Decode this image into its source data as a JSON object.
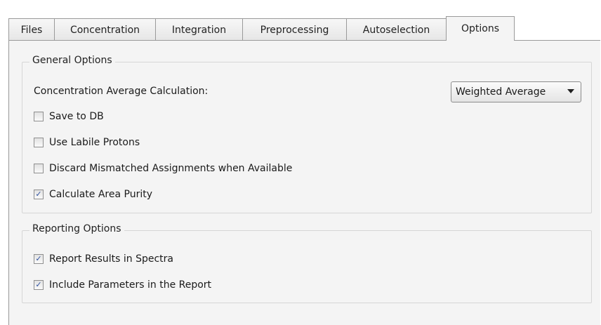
{
  "tabs": [
    {
      "label": "Files",
      "active": false
    },
    {
      "label": "Concentration",
      "active": false
    },
    {
      "label": "Integration",
      "active": false
    },
    {
      "label": "Preprocessing",
      "active": false
    },
    {
      "label": "Autoselection",
      "active": false
    },
    {
      "label": "Options",
      "active": true
    }
  ],
  "general_options": {
    "title": "General Options",
    "avg_calc_label": "Concentration Average Calculation:",
    "avg_calc_value": "Weighted Average",
    "checkboxes": [
      {
        "label": "Save to DB",
        "checked": false
      },
      {
        "label": "Use Labile Protons",
        "checked": false
      },
      {
        "label": "Discard Mismatched Assignments when Available",
        "checked": false
      },
      {
        "label": "Calculate Area Purity",
        "checked": true
      }
    ]
  },
  "reporting_options": {
    "title": "Reporting Options",
    "checkboxes": [
      {
        "label": "Report Results in Spectra",
        "checked": true
      },
      {
        "label": "Include Parameters in the Report",
        "checked": true
      }
    ]
  },
  "icons": {
    "check_mark": "✓",
    "dropdown_arrow": "chevron-down-icon"
  },
  "colors": {
    "panel_bg": "#f4f4f4",
    "check_color": "#2d4f9e"
  }
}
